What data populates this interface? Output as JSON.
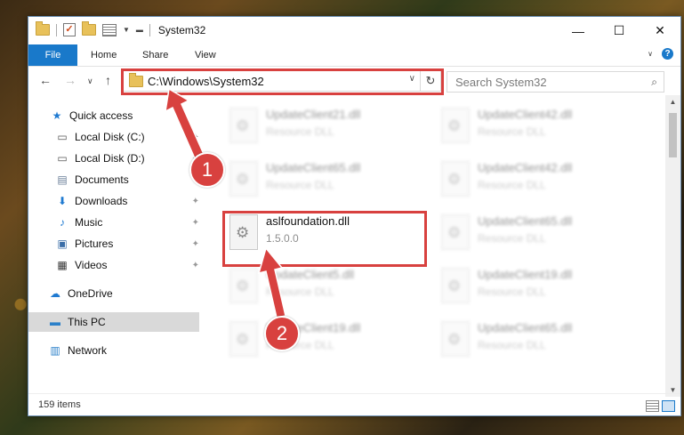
{
  "window": {
    "title": "System32",
    "controls": [
      "—",
      "☐",
      "✕"
    ]
  },
  "ribbon": {
    "file_tab": "File",
    "tabs": [
      "Home",
      "Share",
      "View"
    ]
  },
  "address_bar": {
    "path": "C:\\Windows\\System32",
    "search_placeholder": "Search System32"
  },
  "sidebar": {
    "items": [
      {
        "label": "Quick access"
      },
      {
        "label": "Local Disk (C:)"
      },
      {
        "label": "Local Disk (D:)"
      },
      {
        "label": "Documents"
      },
      {
        "label": "Downloads"
      },
      {
        "label": "Music"
      },
      {
        "label": "Pictures"
      },
      {
        "label": "Videos"
      },
      {
        "label": "OneDrive"
      },
      {
        "label": "This PC"
      },
      {
        "label": "Network"
      }
    ]
  },
  "files": [
    {
      "name": "UpdateClient21.dll",
      "desc": "Resource DLL"
    },
    {
      "name": "UpdateClient42.dll",
      "desc": "Resource DLL"
    },
    {
      "name": "UpdateClient65.dll",
      "desc": "Resource DLL"
    },
    {
      "name": "UpdateClient42.dll",
      "desc": "Resource DLL"
    },
    {
      "name": "aslfoundation.dll",
      "desc": "1.5.0.0"
    },
    {
      "name": "UpdateClient65.dll",
      "desc": "Resource DLL"
    },
    {
      "name": "UpdateClient5.dll",
      "desc": "Resource DLL"
    },
    {
      "name": "UpdateClient19.dll",
      "desc": "Resource DLL"
    },
    {
      "name": "UpdateClient19.dll",
      "desc": "Resource DLL"
    },
    {
      "name": "UpdateClient65.dll",
      "desc": "Resource DLL"
    }
  ],
  "status": {
    "item_count": "159 items"
  },
  "annotations": {
    "step1": "1",
    "step2": "2",
    "color": "#d8413f"
  }
}
